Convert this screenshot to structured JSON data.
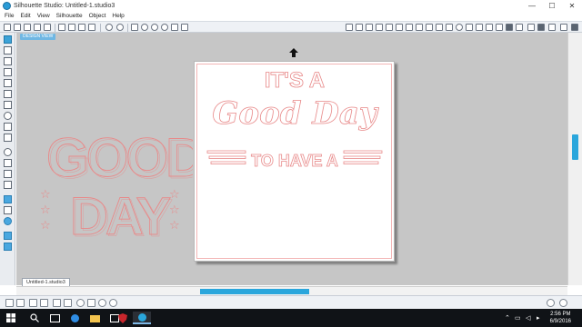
{
  "window": {
    "title": "Silhouette Studio: Untitled-1.studio3",
    "controls": {
      "minimize": "—",
      "maximize": "☐",
      "close": "✕"
    }
  },
  "menu": {
    "items": [
      "File",
      "Edit",
      "View",
      "Silhouette",
      "Object",
      "Help"
    ]
  },
  "canvas": {
    "view_tab": "DESIGN VIEW",
    "page_text": {
      "line1": "IT'S A",
      "line2": "Good Day",
      "line3": "TO HAVE A"
    },
    "side_art": {
      "word1": "GOOD",
      "word2": "DAY",
      "star": "☆"
    }
  },
  "document_tab": "Untitled-1.studio3",
  "taskbar": {
    "start_icon": "windows-icon",
    "time": "2:56 PM",
    "date": "6/9/2016"
  },
  "colors": {
    "accent": "#2aa6dc",
    "outline": "#e88a8a",
    "canvas_bg": "#c6c6c6",
    "taskbar": "#101317"
  }
}
